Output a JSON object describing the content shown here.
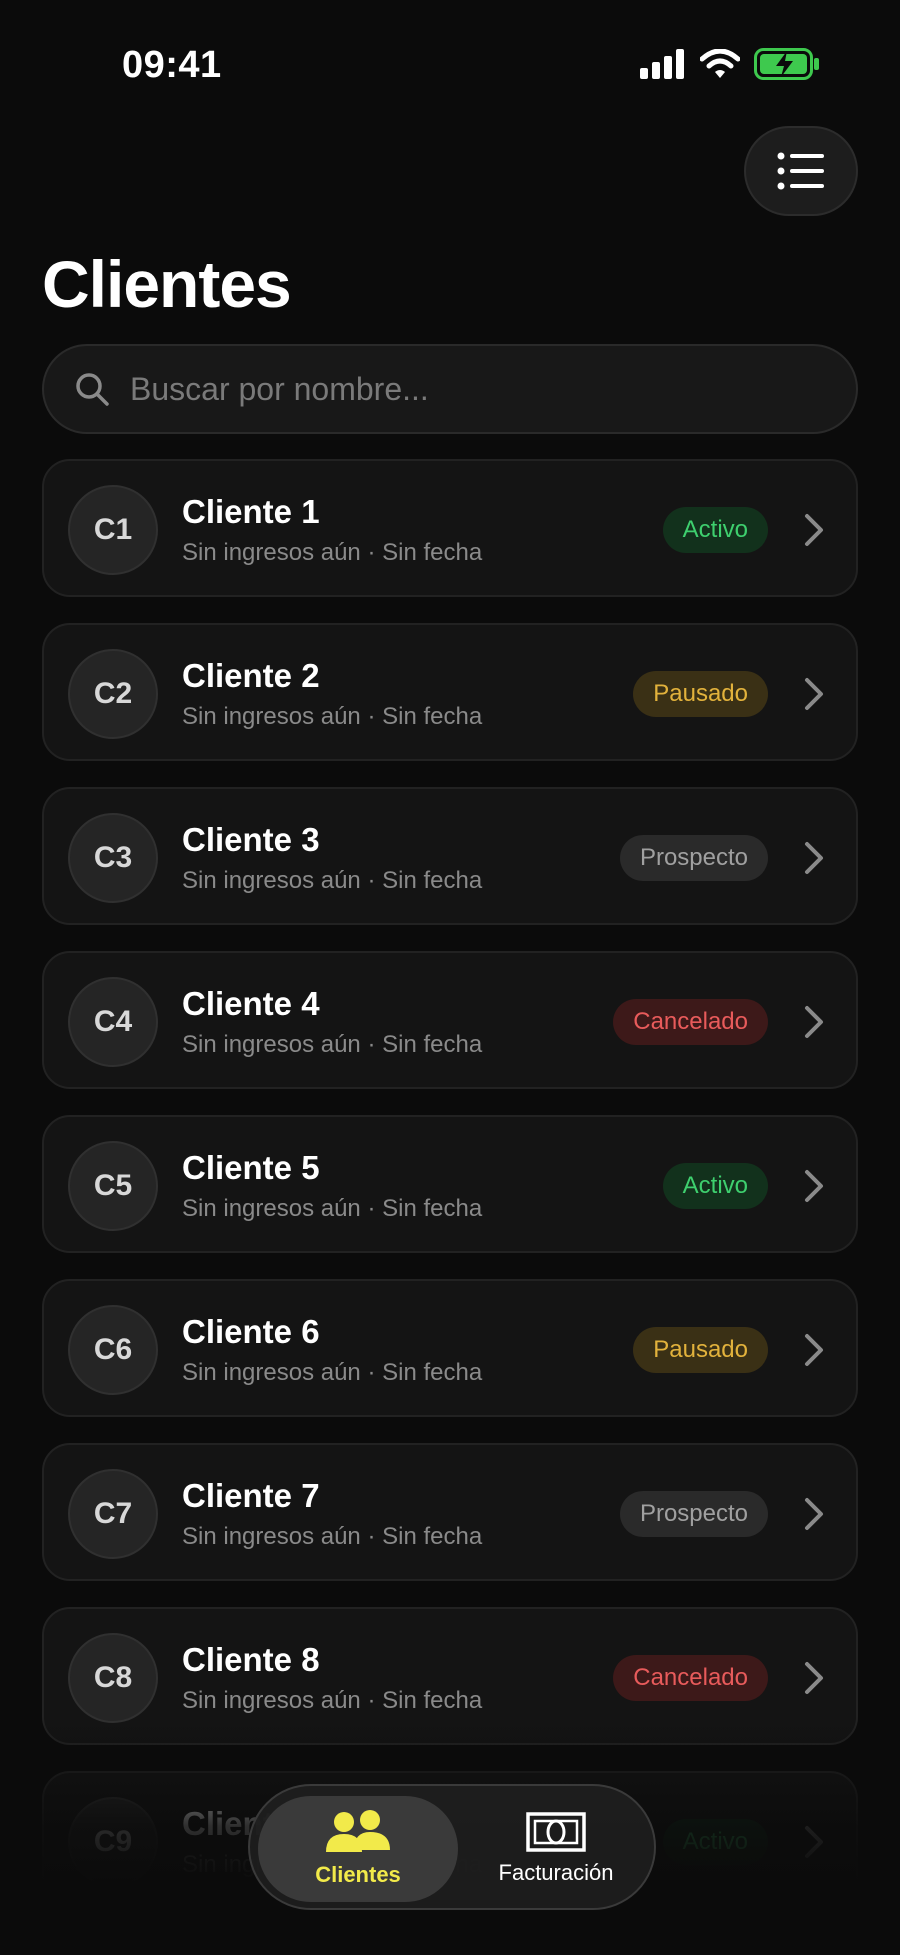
{
  "status": {
    "time": "09:41"
  },
  "header": {
    "title": "Clientes"
  },
  "search": {
    "placeholder": "Buscar por nombre..."
  },
  "colors": {
    "Activo": {
      "bg": "#12311c",
      "fg": "#3ecf6e"
    },
    "Pausado": {
      "bg": "#3a3015",
      "fg": "#e2b23c"
    },
    "Prospecto": {
      "bg": "#2a2a2a",
      "fg": "#a0a0a0"
    },
    "Cancelado": {
      "bg": "#3d1919",
      "fg": "#e85b5b"
    },
    "accent": "#f2ea4a"
  },
  "clients": [
    {
      "initials": "C1",
      "name": "Cliente 1",
      "subtitle": "Sin ingresos aún · Sin fecha",
      "status": "Activo"
    },
    {
      "initials": "C2",
      "name": "Cliente 2",
      "subtitle": "Sin ingresos aún · Sin fecha",
      "status": "Pausado"
    },
    {
      "initials": "C3",
      "name": "Cliente 3",
      "subtitle": "Sin ingresos aún · Sin fecha",
      "status": "Prospecto"
    },
    {
      "initials": "C4",
      "name": "Cliente 4",
      "subtitle": "Sin ingresos aún · Sin fecha",
      "status": "Cancelado"
    },
    {
      "initials": "C5",
      "name": "Cliente 5",
      "subtitle": "Sin ingresos aún · Sin fecha",
      "status": "Activo"
    },
    {
      "initials": "C6",
      "name": "Cliente 6",
      "subtitle": "Sin ingresos aún · Sin fecha",
      "status": "Pausado"
    },
    {
      "initials": "C7",
      "name": "Cliente 7",
      "subtitle": "Sin ingresos aún · Sin fecha",
      "status": "Prospecto"
    },
    {
      "initials": "C8",
      "name": "Cliente 8",
      "subtitle": "Sin ingresos aún · Sin fecha",
      "status": "Cancelado"
    },
    {
      "initials": "C9",
      "name": "Cliente 9",
      "subtitle": "Sin ingresos aún · Sin fecha",
      "status": "Activo"
    }
  ],
  "tabbar": {
    "tabs": [
      {
        "label": "Clientes",
        "icon": "users-icon",
        "active": true
      },
      {
        "label": "Facturación",
        "icon": "banknote-icon",
        "active": false
      }
    ]
  }
}
